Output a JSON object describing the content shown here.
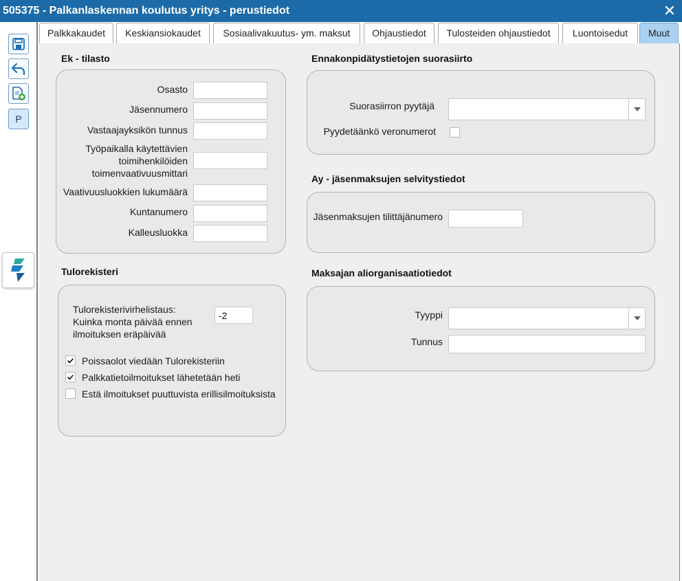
{
  "window": {
    "title": "505375 - Palkanlaskennan koulutus yritys - perustiedot"
  },
  "toolbar": {
    "p_label": "P"
  },
  "tabs": [
    {
      "label": "Palkkakaudet"
    },
    {
      "label": "Keskiansiokaudet"
    },
    {
      "label": "Sosiaalivakuutus- ym. maksut"
    },
    {
      "label": "Ohjaustiedot"
    },
    {
      "label": "Tulosteiden ohjaustiedot"
    },
    {
      "label": "Luontoisedut"
    },
    {
      "label": "Muut",
      "active": true
    }
  ],
  "ek_tilasto": {
    "title": "Ek - tilasto",
    "fields": [
      {
        "label": "Osasto",
        "value": ""
      },
      {
        "label": "Jäsennumero",
        "value": ""
      },
      {
        "label": "Vastaajayksikön tunnus",
        "value": ""
      },
      {
        "label_lines": [
          "Työpaikalla käytettävien",
          "toimihenkilöiden",
          "toimenvaativuusmittari"
        ],
        "value": ""
      },
      {
        "label": "Vaativuusluokkien lukumäärä",
        "value": ""
      },
      {
        "label": "Kuntanumero",
        "value": ""
      },
      {
        "label": "Kalleusluokka",
        "value": ""
      }
    ]
  },
  "tulorekisteri": {
    "title": "Tulorekisteri",
    "virhelistaus_label_lines": [
      "Tulorekisterivirhelistaus:",
      "Kuinka monta päivää ennen",
      "ilmoituksen eräpäivää"
    ],
    "virhelistaus_value": "-2",
    "checkboxes": [
      {
        "label": "Poissaolot viedään Tulorekisteriin",
        "checked": true
      },
      {
        "label": "Palkkatietoilmoitukset lähetetään heti",
        "checked": true
      },
      {
        "label": "Estä ilmoitukset puuttuvista erillisilmoituksista",
        "checked": false
      }
    ]
  },
  "ennakonpidatys": {
    "title": "Ennakonpidätystietojen suorasiirto",
    "pyytaja_label": "Suorasiirron pyytäjä",
    "pyytaja_value": "",
    "veronumerot_label": "Pyydetäänkö veronumerot",
    "veronumerot_checked": false
  },
  "ay_jasenmaksut": {
    "title": "Ay - jäsenmaksujen selvitystiedot",
    "tilittaja_label": "Jäsenmaksujen tilittäjänumero",
    "tilittaja_value": ""
  },
  "aliorganisaatio": {
    "title": "Maksajan aliorganisaatiotiedot",
    "tyyppi_label": "Tyyppi",
    "tyyppi_value": "",
    "tunnus_label": "Tunnus",
    "tunnus_value": ""
  },
  "colors": {
    "titlebar": "#1c6ba8",
    "active_tab": "#a9d1f1",
    "panel": "#e9e9e9",
    "content_bg": "#efefef"
  },
  "icons": [
    "save-icon",
    "undo-icon",
    "new-document-icon",
    "app-logo-icon",
    "close-icon",
    "chevron-down-icon",
    "checkmark-icon"
  ]
}
